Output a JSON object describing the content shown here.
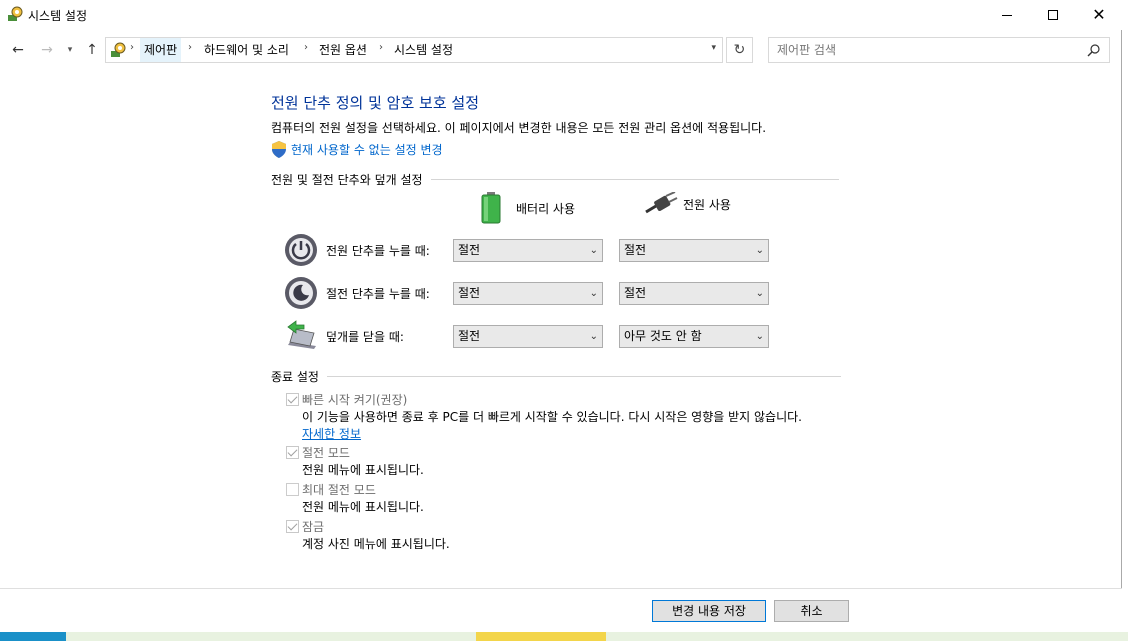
{
  "window": {
    "title": "시스템 설정"
  },
  "nav": {
    "breadcrumbs": [
      "제어판",
      "하드웨어 및 소리",
      "전원 옵션",
      "시스템 설정"
    ],
    "search_placeholder": "제어판 검색"
  },
  "main": {
    "title": "전원 단추 정의 및 암호 보호 설정",
    "description": "컴퓨터의 전원 설정을 선택하세요. 이 페이지에서 변경한 내용은 모든 전원 관리 옵션에 적용됩니다.",
    "admin_link": "현재 사용할 수 없는 설정 변경",
    "power_section_title": "전원 및 절전 단추와 덮개 설정",
    "col_battery": "배터리 사용",
    "col_plugged": "전원 사용",
    "rows": [
      {
        "label": "전원 단추를 누를 때:",
        "battery": "절전",
        "plugged": "절전"
      },
      {
        "label": "절전 단추를 누를 때:",
        "battery": "절전",
        "plugged": "절전"
      },
      {
        "label": "덮개를 닫을 때:",
        "battery": "절전",
        "plugged": "아무 것도 안 함"
      }
    ],
    "shutdown_section_title": "종료 설정",
    "shutdown_options": [
      {
        "label": "빠른 시작 켜기(권장)",
        "desc": "이 기능을 사용하면 종료 후 PC를 더 빠르게 시작할 수 있습니다. 다시 시작은 영향을 받지 않습니다.",
        "link": "자세한 정보",
        "checked": true
      },
      {
        "label": "절전 모드",
        "desc": "전원 메뉴에 표시됩니다.",
        "checked": true
      },
      {
        "label": "최대 절전 모드",
        "desc": "전원 메뉴에 표시됩니다.",
        "checked": false
      },
      {
        "label": "잠금",
        "desc": "계정 사진 메뉴에 표시됩니다.",
        "checked": true
      }
    ]
  },
  "footer": {
    "save_label": "변경 내용 저장",
    "cancel_label": "취소"
  }
}
